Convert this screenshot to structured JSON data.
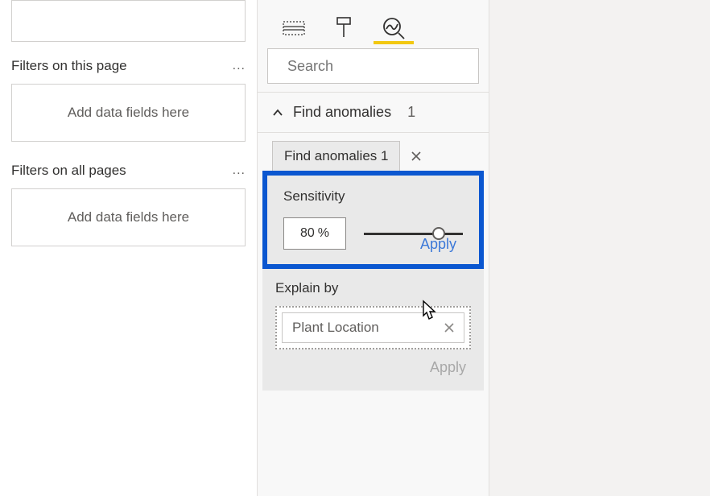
{
  "filters": {
    "page_section": "Filters on this page",
    "all_section": "Filters on all pages",
    "placeholder": "Add data fields here"
  },
  "panel": {
    "search_placeholder": "Search",
    "accordion": {
      "title": "Find anomalies",
      "count": "1"
    },
    "tab_chip": "Find anomalies 1",
    "sensitivity": {
      "label": "Sensitivity",
      "value": "80",
      "unit": "%",
      "apply": "Apply"
    },
    "explain": {
      "label": "Explain by",
      "field": "Plant Location",
      "apply": "Apply"
    }
  }
}
